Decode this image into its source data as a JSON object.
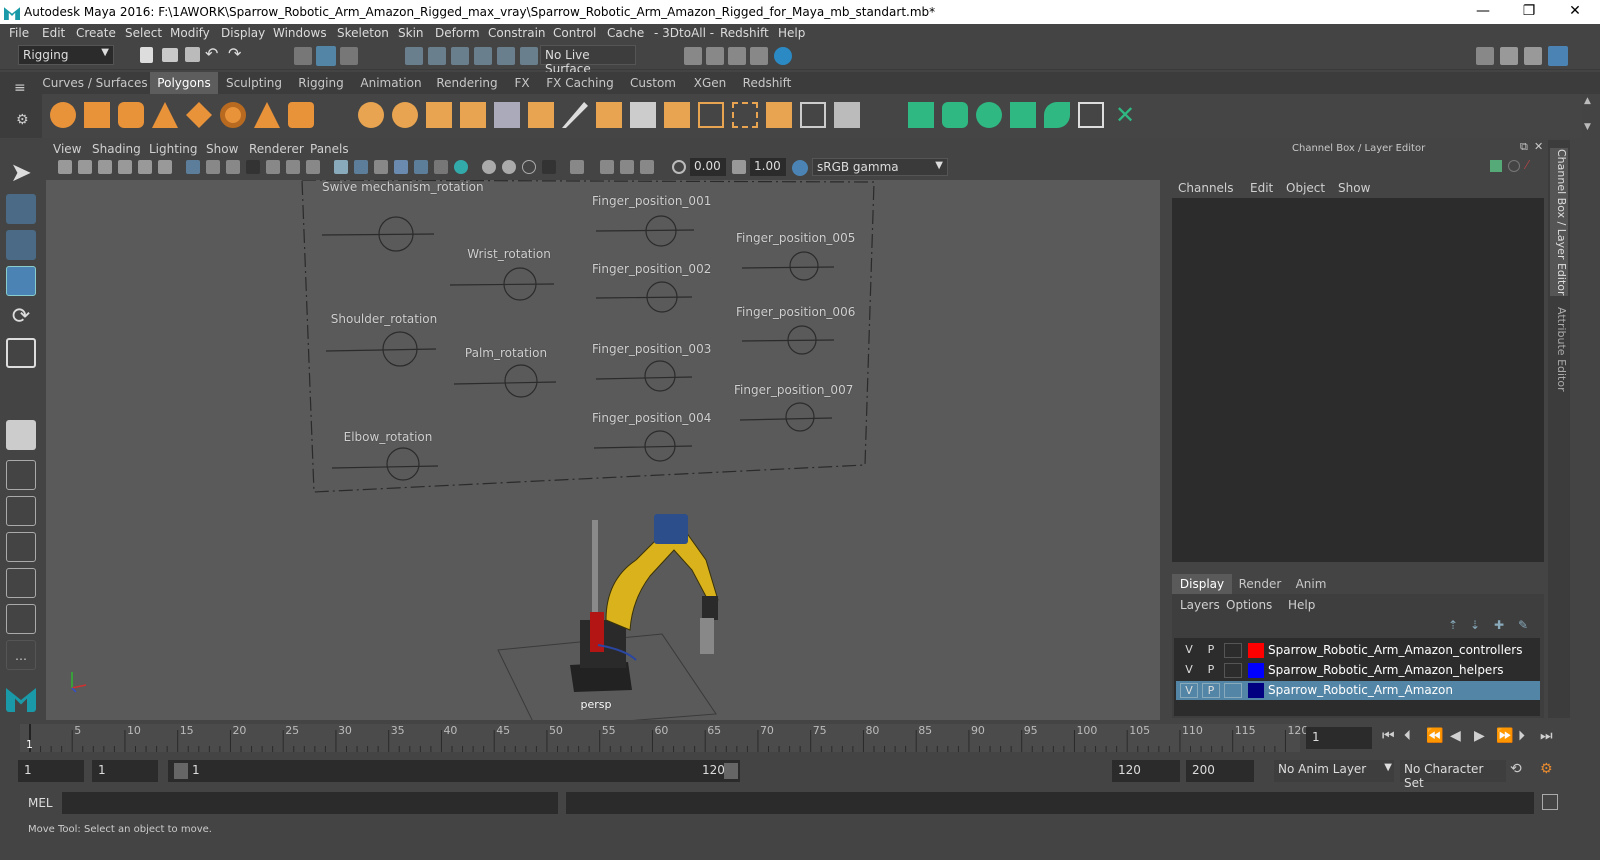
{
  "window": {
    "title": "Autodesk Maya 2016: F:\\1AWORK\\Sparrow_Robotic_Arm_Amazon_Rigged_max_vray\\Sparrow_Robotic_Arm_Amazon_Rigged_for_Maya_mb_standart.mb*",
    "minimize": "—",
    "restore": "❐",
    "close": "✕"
  },
  "menu": [
    "File",
    "Edit",
    "Create",
    "Select",
    "Modify",
    "Display",
    "Windows",
    "Skeleton",
    "Skin",
    "Deform",
    "Constrain",
    "Control",
    "Cache",
    "- 3DtoAll -",
    "Redshift",
    "Help"
  ],
  "status": {
    "mode_select": "Rigging",
    "live_surface": "No Live Surface"
  },
  "shelf_tabs": [
    "Curves / Surfaces",
    "Polygons",
    "Sculpting",
    "Rigging",
    "Animation",
    "Rendering",
    "FX",
    "FX Caching",
    "Custom",
    "XGen",
    "Redshift"
  ],
  "shelf_active": "Polygons",
  "viewport": {
    "menu": [
      "View",
      "Shading",
      "Lighting",
      "Show",
      "Renderer",
      "Panels"
    ],
    "exposure": "0.00",
    "gamma": "1.00",
    "colorspace": "sRGB gamma",
    "camera_label": "persp",
    "controls": [
      "Swive mechanism_rotation",
      "Wrist_rotation",
      "Shoulder_rotation",
      "Palm_rotation",
      "Elbow_rotation",
      "Finger_position_001",
      "Finger_position_002",
      "Finger_position_003",
      "Finger_position_004",
      "Finger_position_005",
      "Finger_position_006",
      "Finger_position_007"
    ]
  },
  "channel_box": {
    "title": "Channel Box / Layer Editor",
    "menu": [
      "Channels",
      "Edit",
      "Object",
      "Show"
    ],
    "layer_tabs": [
      "Display",
      "Render",
      "Anim"
    ],
    "layer_menu": [
      "Layers",
      "Options",
      "Help"
    ],
    "layers": [
      {
        "v": "V",
        "p": "P",
        "name": "Sparrow_Robotic_Arm_Amazon_controllers",
        "color": "#ff0000",
        "selected": false
      },
      {
        "v": "V",
        "p": "P",
        "name": "Sparrow_Robotic_Arm_Amazon_helpers",
        "color": "#0000ff",
        "selected": false
      },
      {
        "v": "V",
        "p": "P",
        "name": "Sparrow_Robotic_Arm_Amazon",
        "color": "#000080",
        "selected": true
      }
    ]
  },
  "side_tabs": [
    "Channel Box / Layer Editor",
    "Attribute Editor"
  ],
  "timeline": {
    "ticks": [
      "5",
      "10",
      "15",
      "20",
      "25",
      "30",
      "35",
      "40",
      "45",
      "50",
      "55",
      "60",
      "65",
      "70",
      "75",
      "80",
      "85",
      "90",
      "95",
      "100",
      "105",
      "110",
      "115",
      "120"
    ],
    "current_start_label": "1",
    "current_frame": "1"
  },
  "range": {
    "start": "1",
    "playback_start": "1",
    "slider_start": "1",
    "slider_end": "120",
    "playback_end": "120",
    "end": "200",
    "anim_layer": "No Anim Layer",
    "character_set": "No Character Set"
  },
  "command": {
    "lang": "MEL"
  },
  "help_line": "Move Tool: Select an object to move."
}
